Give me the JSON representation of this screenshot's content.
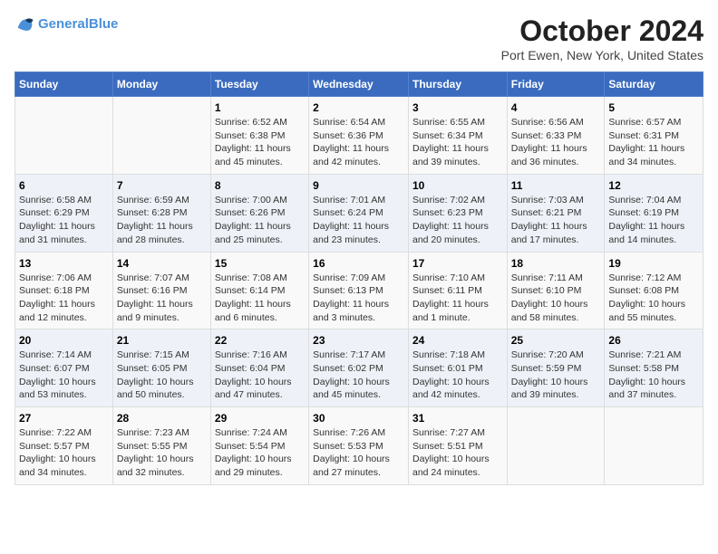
{
  "header": {
    "logo_line1": "General",
    "logo_line2": "Blue",
    "month": "October 2024",
    "location": "Port Ewen, New York, United States"
  },
  "days_of_week": [
    "Sunday",
    "Monday",
    "Tuesday",
    "Wednesday",
    "Thursday",
    "Friday",
    "Saturday"
  ],
  "weeks": [
    [
      {
        "day": "",
        "info": ""
      },
      {
        "day": "",
        "info": ""
      },
      {
        "day": "1",
        "info": "Sunrise: 6:52 AM\nSunset: 6:38 PM\nDaylight: 11 hours and 45 minutes."
      },
      {
        "day": "2",
        "info": "Sunrise: 6:54 AM\nSunset: 6:36 PM\nDaylight: 11 hours and 42 minutes."
      },
      {
        "day": "3",
        "info": "Sunrise: 6:55 AM\nSunset: 6:34 PM\nDaylight: 11 hours and 39 minutes."
      },
      {
        "day": "4",
        "info": "Sunrise: 6:56 AM\nSunset: 6:33 PM\nDaylight: 11 hours and 36 minutes."
      },
      {
        "day": "5",
        "info": "Sunrise: 6:57 AM\nSunset: 6:31 PM\nDaylight: 11 hours and 34 minutes."
      }
    ],
    [
      {
        "day": "6",
        "info": "Sunrise: 6:58 AM\nSunset: 6:29 PM\nDaylight: 11 hours and 31 minutes."
      },
      {
        "day": "7",
        "info": "Sunrise: 6:59 AM\nSunset: 6:28 PM\nDaylight: 11 hours and 28 minutes."
      },
      {
        "day": "8",
        "info": "Sunrise: 7:00 AM\nSunset: 6:26 PM\nDaylight: 11 hours and 25 minutes."
      },
      {
        "day": "9",
        "info": "Sunrise: 7:01 AM\nSunset: 6:24 PM\nDaylight: 11 hours and 23 minutes."
      },
      {
        "day": "10",
        "info": "Sunrise: 7:02 AM\nSunset: 6:23 PM\nDaylight: 11 hours and 20 minutes."
      },
      {
        "day": "11",
        "info": "Sunrise: 7:03 AM\nSunset: 6:21 PM\nDaylight: 11 hours and 17 minutes."
      },
      {
        "day": "12",
        "info": "Sunrise: 7:04 AM\nSunset: 6:19 PM\nDaylight: 11 hours and 14 minutes."
      }
    ],
    [
      {
        "day": "13",
        "info": "Sunrise: 7:06 AM\nSunset: 6:18 PM\nDaylight: 11 hours and 12 minutes."
      },
      {
        "day": "14",
        "info": "Sunrise: 7:07 AM\nSunset: 6:16 PM\nDaylight: 11 hours and 9 minutes."
      },
      {
        "day": "15",
        "info": "Sunrise: 7:08 AM\nSunset: 6:14 PM\nDaylight: 11 hours and 6 minutes."
      },
      {
        "day": "16",
        "info": "Sunrise: 7:09 AM\nSunset: 6:13 PM\nDaylight: 11 hours and 3 minutes."
      },
      {
        "day": "17",
        "info": "Sunrise: 7:10 AM\nSunset: 6:11 PM\nDaylight: 11 hours and 1 minute."
      },
      {
        "day": "18",
        "info": "Sunrise: 7:11 AM\nSunset: 6:10 PM\nDaylight: 10 hours and 58 minutes."
      },
      {
        "day": "19",
        "info": "Sunrise: 7:12 AM\nSunset: 6:08 PM\nDaylight: 10 hours and 55 minutes."
      }
    ],
    [
      {
        "day": "20",
        "info": "Sunrise: 7:14 AM\nSunset: 6:07 PM\nDaylight: 10 hours and 53 minutes."
      },
      {
        "day": "21",
        "info": "Sunrise: 7:15 AM\nSunset: 6:05 PM\nDaylight: 10 hours and 50 minutes."
      },
      {
        "day": "22",
        "info": "Sunrise: 7:16 AM\nSunset: 6:04 PM\nDaylight: 10 hours and 47 minutes."
      },
      {
        "day": "23",
        "info": "Sunrise: 7:17 AM\nSunset: 6:02 PM\nDaylight: 10 hours and 45 minutes."
      },
      {
        "day": "24",
        "info": "Sunrise: 7:18 AM\nSunset: 6:01 PM\nDaylight: 10 hours and 42 minutes."
      },
      {
        "day": "25",
        "info": "Sunrise: 7:20 AM\nSunset: 5:59 PM\nDaylight: 10 hours and 39 minutes."
      },
      {
        "day": "26",
        "info": "Sunrise: 7:21 AM\nSunset: 5:58 PM\nDaylight: 10 hours and 37 minutes."
      }
    ],
    [
      {
        "day": "27",
        "info": "Sunrise: 7:22 AM\nSunset: 5:57 PM\nDaylight: 10 hours and 34 minutes."
      },
      {
        "day": "28",
        "info": "Sunrise: 7:23 AM\nSunset: 5:55 PM\nDaylight: 10 hours and 32 minutes."
      },
      {
        "day": "29",
        "info": "Sunrise: 7:24 AM\nSunset: 5:54 PM\nDaylight: 10 hours and 29 minutes."
      },
      {
        "day": "30",
        "info": "Sunrise: 7:26 AM\nSunset: 5:53 PM\nDaylight: 10 hours and 27 minutes."
      },
      {
        "day": "31",
        "info": "Sunrise: 7:27 AM\nSunset: 5:51 PM\nDaylight: 10 hours and 24 minutes."
      },
      {
        "day": "",
        "info": ""
      },
      {
        "day": "",
        "info": ""
      }
    ]
  ]
}
